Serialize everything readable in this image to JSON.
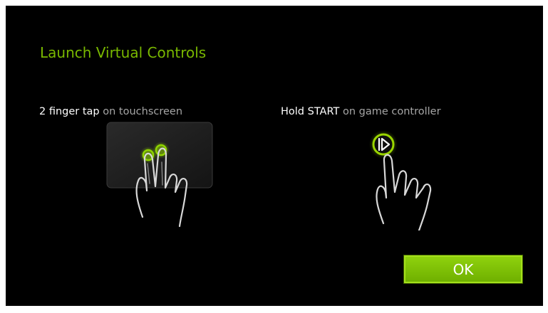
{
  "dialog": {
    "title": "Launch Virtual Controls",
    "left_instruction": {
      "action": "2 finger tap",
      "detail": "on touchscreen"
    },
    "right_instruction": {
      "action": "Hold START",
      "detail": "on game controller"
    },
    "ok_label": "OK"
  },
  "icons": {
    "touch": "two-finger-tap-icon",
    "controller": "hold-start-button-icon"
  },
  "colors": {
    "accent": "#79b800",
    "button": "#7cc000",
    "background": "#000000"
  }
}
